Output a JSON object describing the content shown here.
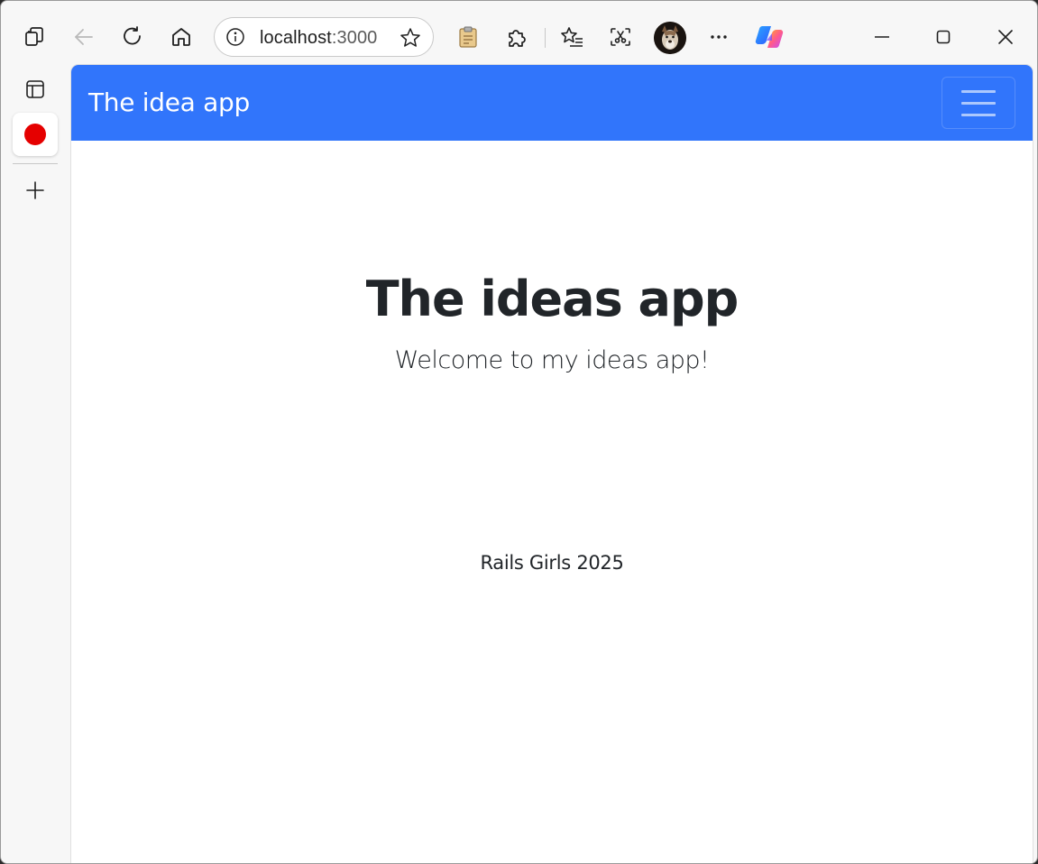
{
  "browser": {
    "address": {
      "host": "localhost",
      "port": ":3000"
    },
    "icons": {
      "tabs": "tab-actions-icon",
      "back": "back-arrow-icon",
      "refresh": "refresh-icon",
      "home": "home-icon",
      "site_info": "info-icon",
      "favorite": "star-icon",
      "clipboard": "clipboard-icon",
      "extensions": "puzzle-icon",
      "favorites": "favorites-icon",
      "screenshot": "screenshot-icon",
      "more": "more-icon",
      "copilot": "copilot-icon"
    },
    "window_controls": [
      "minimize",
      "maximize",
      "close"
    ]
  },
  "sidebar": {
    "items": [
      "tab-layout-icon",
      "record-icon",
      "add-icon"
    ],
    "record_color": "#e50000"
  },
  "page": {
    "navbar": {
      "brand": "The idea app",
      "color": "#3175fb"
    },
    "hero": {
      "title": "The ideas app",
      "lead": "Welcome to my ideas app!"
    },
    "footer": {
      "text": "Rails Girls 2025"
    }
  }
}
